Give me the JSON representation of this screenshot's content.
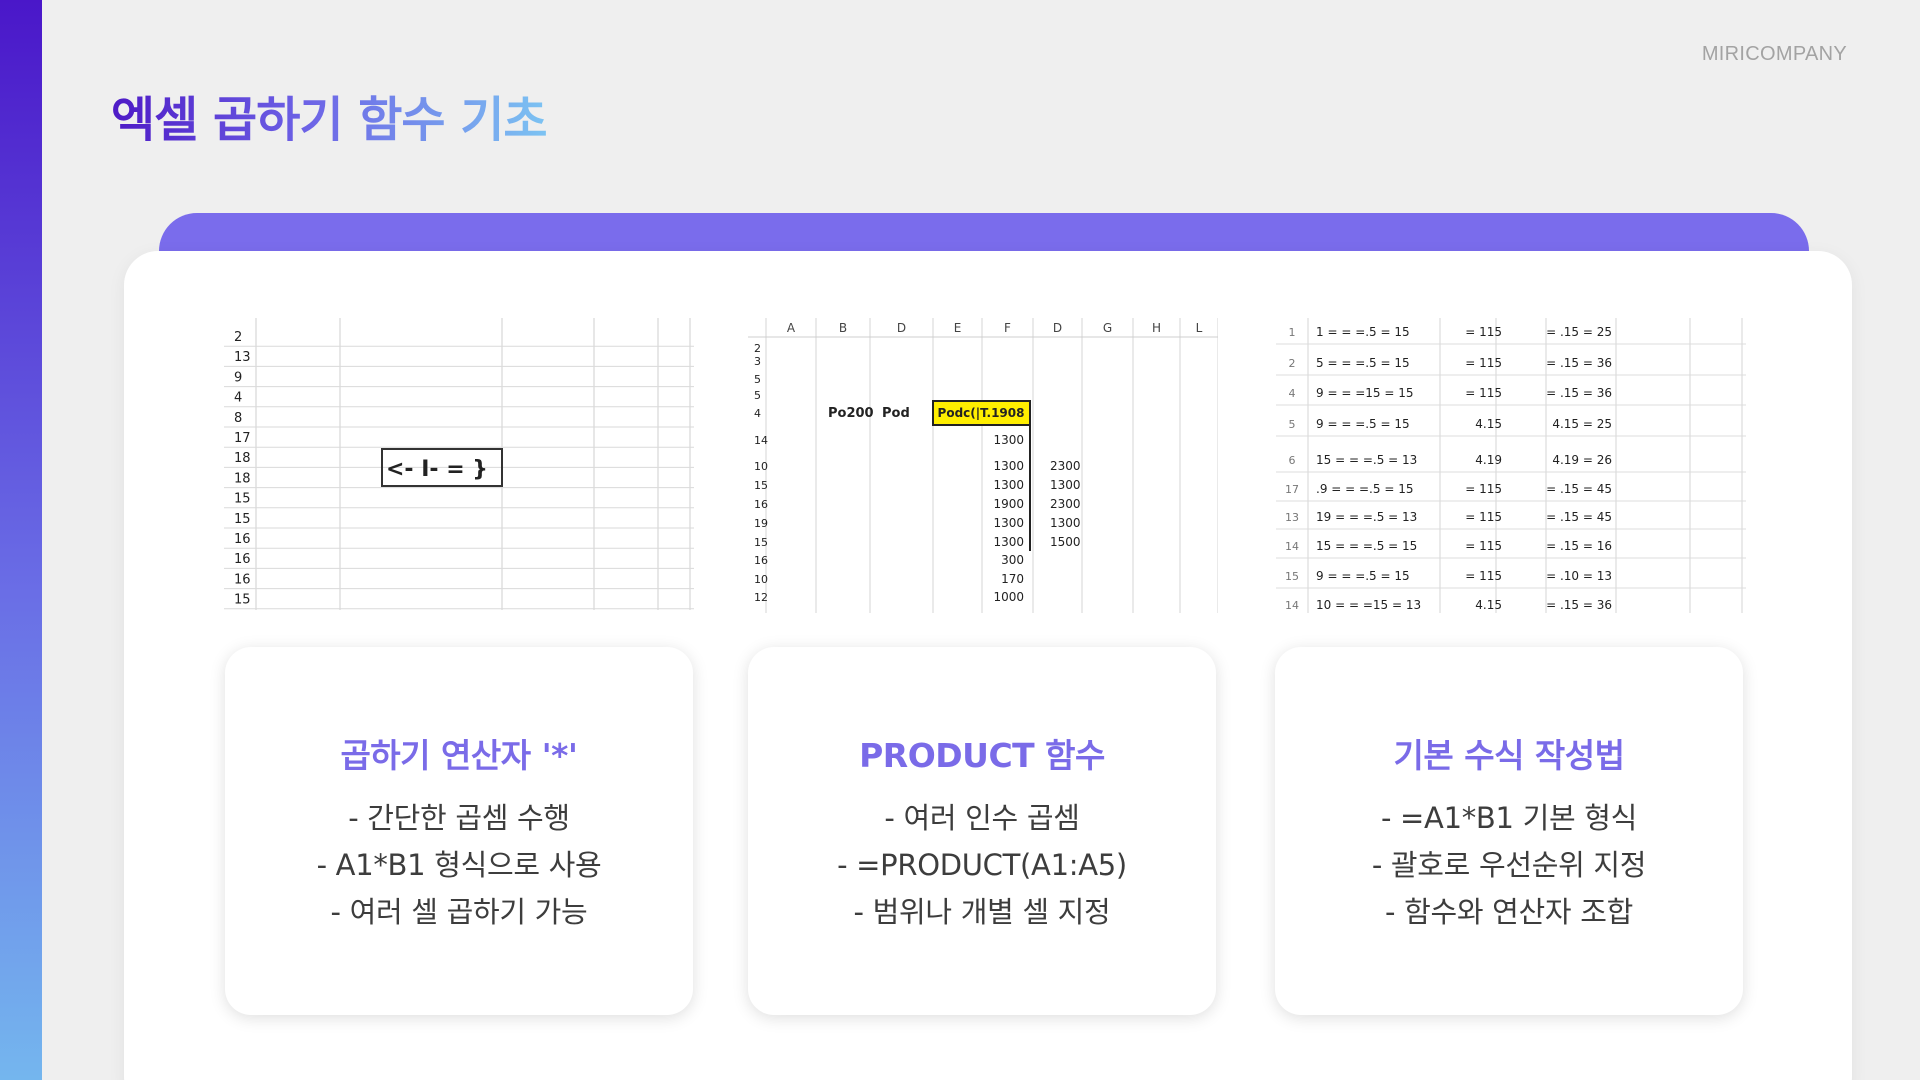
{
  "brand": "MIRICOMPANY",
  "title": "엑셀 곱하기 함수 기초",
  "sheet1": {
    "rows": [
      "2",
      "13",
      "9",
      "4",
      "8",
      "17",
      "18",
      "18",
      "15",
      "15",
      "16",
      "16",
      "16",
      "15"
    ],
    "cell_text": "<- I- = }"
  },
  "sheet2": {
    "cols": [
      "",
      "A",
      "B",
      "D",
      "E",
      "F",
      "D",
      "G",
      "H",
      "L"
    ],
    "rows": [
      {
        "n": "2",
        "b": "",
        "d": "",
        "f": "",
        "g": ""
      },
      {
        "n": "3",
        "b": "",
        "d": "",
        "f": "",
        "g": ""
      },
      {
        "n": "5",
        "b": "",
        "d": "",
        "f": "",
        "g": ""
      },
      {
        "n": "5",
        "b": "",
        "d": "",
        "f": "",
        "g": ""
      },
      {
        "n": "4",
        "b": "Po200",
        "d": "Pod",
        "f": "Podc(|T.1908",
        "g": ""
      },
      {
        "n": "14",
        "b": "",
        "d": "",
        "f": "1300",
        "g": ""
      },
      {
        "n": "10",
        "b": "",
        "d": "",
        "f": "1300",
        "g": "2300"
      },
      {
        "n": "15",
        "b": "",
        "d": "",
        "f": "1300",
        "g": "1300"
      },
      {
        "n": "16",
        "b": "",
        "d": "",
        "f": "1900",
        "g": "2300"
      },
      {
        "n": "19",
        "b": "",
        "d": "",
        "f": "1300",
        "g": "1300"
      },
      {
        "n": "15",
        "b": "",
        "d": "",
        "f": "1300",
        "g": "1500"
      },
      {
        "n": "16",
        "b": "",
        "d": "",
        "f": "300",
        "g": ""
      },
      {
        "n": "10",
        "b": "",
        "d": "",
        "f": "170",
        "g": ""
      },
      {
        "n": "12",
        "b": "",
        "d": "",
        "f": "1000",
        "g": ""
      }
    ]
  },
  "sheet3": {
    "rows": [
      {
        "n": "1",
        "a": "1 = = =.5 = 15",
        "b": "= 115",
        "c": "= .15 = 25"
      },
      {
        "n": "2",
        "a": "5 = = =.5 = 15",
        "b": "= 115",
        "c": "= .15 = 36"
      },
      {
        "n": "4",
        "a": "9 = = =15 = 15",
        "b": "= 115",
        "c": "= .15 = 36"
      },
      {
        "n": "5",
        "a": "9 = = =.5 = 15",
        "b": "4.15",
        "c": "4.15 = 25"
      },
      {
        "n": "6",
        "a": "15 = = =.5 = 13",
        "b": "4.19",
        "c": "4.19 = 26"
      },
      {
        "n": "17",
        "a": ".9 = = =.5 = 15",
        "b": "= 115",
        "c": "= .15 = 45"
      },
      {
        "n": "13",
        "a": "19 = = =.5 = 13",
        "b": "= 115",
        "c": "= .15 = 45"
      },
      {
        "n": "14",
        "a": "15 = = =.5 = 15",
        "b": "= 115",
        "c": "= .15 = 16"
      },
      {
        "n": "15",
        "a": "9 = = =.5 = 15",
        "b": "= 115",
        "c": "= .10 = 13"
      },
      {
        "n": "14",
        "a": "10 = = =15 = 13",
        "b": "4.15",
        "c": "= .15 = 36"
      }
    ]
  },
  "cards": [
    {
      "title": "곱하기 연산자 '*'",
      "lines": [
        "- 간단한 곱셈 수행",
        "- A1*B1 형식으로 사용",
        "- 여러 셀 곱하기 가능"
      ]
    },
    {
      "title": "PRODUCT 함수",
      "lines": [
        "- 여러 인수 곱셈",
        "- =PRODUCT(A1:A5)",
        "- 범위나 개별 셀 지정"
      ]
    },
    {
      "title": "기본 수식 작성법",
      "lines": [
        "- =A1*B1 기본 형식",
        "- 괄호로 우선순위 지정",
        "- 함수와 연산자 조합"
      ]
    }
  ],
  "colors": {
    "accent": "#7a6cec",
    "highlight": "#ffee00"
  }
}
